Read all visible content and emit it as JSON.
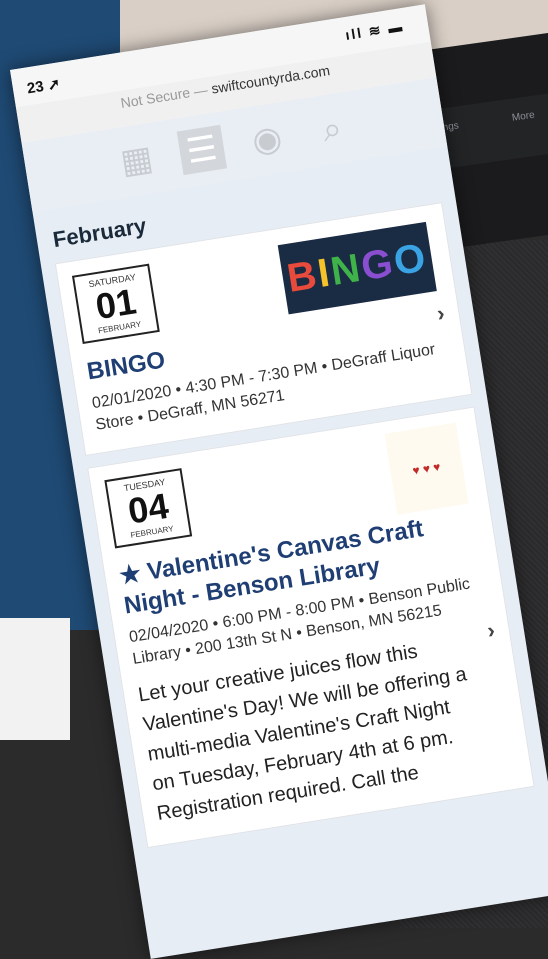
{
  "status_bar": {
    "time": "23",
    "location_glyph": "➚",
    "signal": "ıll ≋ ▬"
  },
  "url_bar": {
    "security": "Not Secure",
    "separator": " — ",
    "domain": "swiftcountyrda.com"
  },
  "toolbar": {
    "icons": [
      "grid-icon",
      "list-icon",
      "eye-icon",
      "search-icon"
    ],
    "glyphs": [
      "▦",
      "☰",
      "◉",
      "⌕"
    ]
  },
  "background": {
    "tablet_labels": [
      "Settings",
      "More"
    ]
  },
  "month_heading": "February",
  "events": [
    {
      "day_of_week": "SATURDAY",
      "day": "01",
      "month": "FEBRUARY",
      "thumbnail_text": "BINGO",
      "title": "BINGO",
      "meta": "02/01/2020 • 4:30 PM - 7:30 PM • DeGraff Liquor Store • DeGraff, MN 56271",
      "chevron": "›"
    },
    {
      "day_of_week": "TUESDAY",
      "day": "04",
      "month": "FEBRUARY",
      "thumbnail_text": "♥ ♥ ♥",
      "title": "★ Valentine's Canvas Craft Night - Benson Library",
      "meta": "02/04/2020 • 6:00 PM - 8:00 PM • Benson Public Library • 200 13th St N • Benson, MN 56215",
      "description": "Let your creative juices flow this Valentine's Day! We will be offering a multi-media Valentine's Craft Night on Tuesday, February 4th  at 6 pm. Registration required. Call the",
      "chevron": "›"
    }
  ]
}
